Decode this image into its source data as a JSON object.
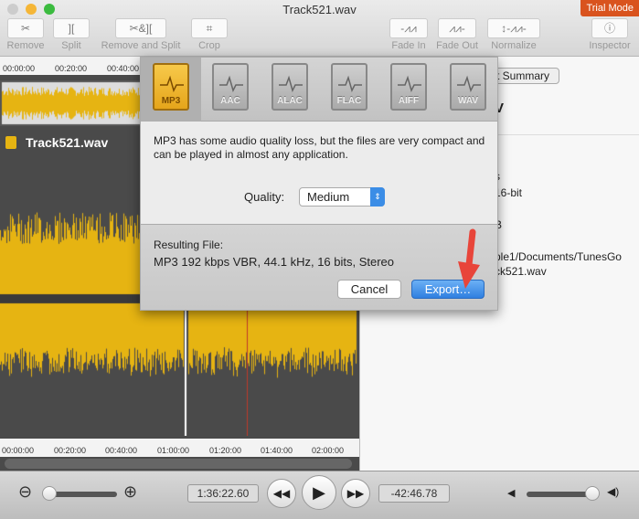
{
  "window": {
    "title": "Track521.wav",
    "trial_badge": "Trial Mode"
  },
  "toolbar": {
    "remove": "Remove",
    "split": "Split",
    "remove_split": "Remove and Split",
    "crop": "Crop",
    "fade_in": "Fade In",
    "fade_out": "Fade Out",
    "normalize": "Normalize",
    "inspector": "Inspector"
  },
  "ruler_top": [
    "00:00:00",
    "00:20:00",
    "00:40:00"
  ],
  "ruler_bottom": [
    "00:00:00",
    "00:20:00",
    "00:40:00",
    "01:00:00",
    "01:20:00",
    "01:40:00",
    "02:00:00"
  ],
  "track": {
    "name": "Track521.wav",
    "waveform_color": "#e6b412"
  },
  "inspector": {
    "tab": "t Summary",
    "title_fragment": "V",
    "lines": [
      "s",
      "16-bit",
      "B",
      "ple1/Documents/TunesGo",
      "ck521.wav"
    ]
  },
  "export": {
    "formats": [
      {
        "label": "MP3",
        "selected": true
      },
      {
        "label": "AAC"
      },
      {
        "label": "ALAC"
      },
      {
        "label": "FLAC"
      },
      {
        "label": "AIFF"
      },
      {
        "label": "WAV"
      }
    ],
    "description": "MP3 has some audio quality loss, but the files are very compact and can be played in almost any application.",
    "quality_label": "Quality:",
    "quality_value": "Medium",
    "result_label": "Resulting File:",
    "result_value": "MP3 192 kbps VBR, 44.1 kHz, 16 bits, Stereo",
    "cancel": "Cancel",
    "export": "Export…"
  },
  "transport": {
    "elapsed": "1:36:22.60",
    "remaining": "-42:46.78",
    "volume": 0.9,
    "zoom": 0.0
  },
  "colors": {
    "accent": "#3b8de6",
    "trial": "#d9531e",
    "arrow": "#e8453a"
  }
}
